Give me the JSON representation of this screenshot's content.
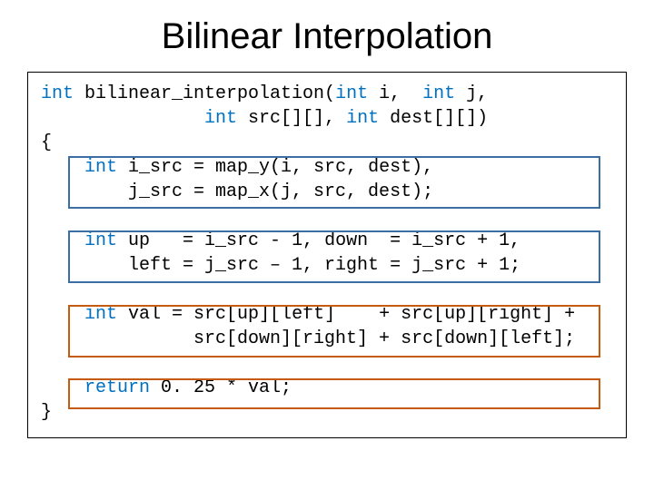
{
  "title": "Bilinear Interpolation",
  "code": {
    "sig1": "int bilinear_interpolation(int i,  int j,",
    "sig2": "               int src[][], int dest[][])",
    "brace_open": "{",
    "blk1a": "    int i_src = map_y(i, src, dest),",
    "blk1b": "        j_src = map_x(j, src, dest);",
    "blk2a": "    int up   = i_src - 1, down  = i_src + 1,",
    "blk2b": "        left = j_src – 1, right = j_src + 1;",
    "blk3a": "    int val = src[up][left]    + src[up][right] +",
    "blk3b": "              src[down][right] + src[down][left];",
    "ret": "    return 0. 25 * val;",
    "brace_close": "}"
  }
}
